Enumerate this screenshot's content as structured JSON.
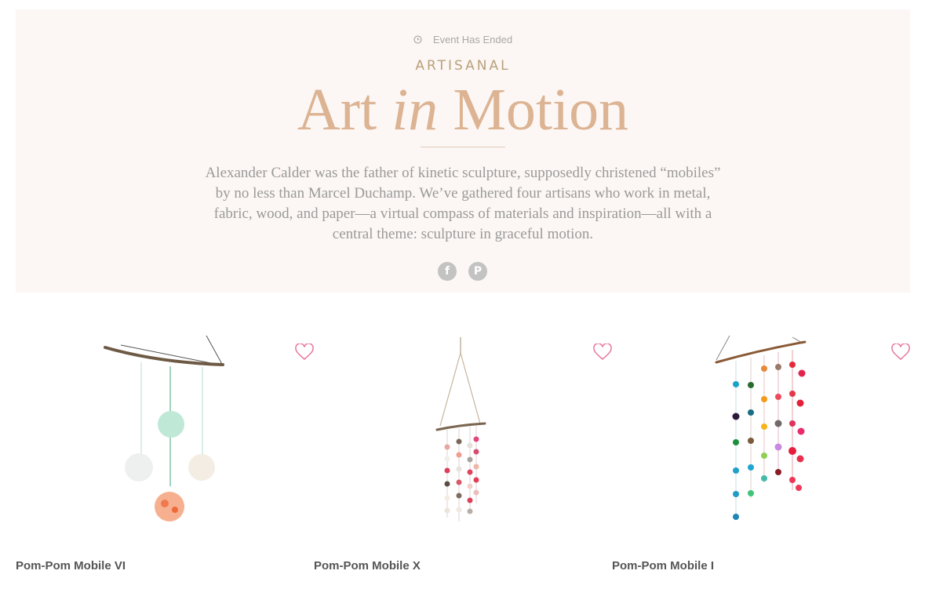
{
  "event": {
    "status": "Event Has Ended",
    "status_icon": "clock-icon"
  },
  "hero": {
    "eyebrow": "ARTISANAL",
    "title_before": "Art ",
    "title_em": "in",
    "title_after": " Motion",
    "description": "Alexander Calder was the father of kinetic sculpture, supposedly christened “mobiles” by no less than Marcel Duchamp. We’ve gathered four artisans who work in metal, fabric, wood, and paper—a virtual compass of materials and inspiration—all with a central theme: sculpture in graceful motion.",
    "background_color": "#fcf7f4",
    "title_color": "#dcb393"
  },
  "share": {
    "facebook_icon": "facebook-icon",
    "facebook_glyph": "f",
    "pinterest_icon": "pinterest-icon",
    "pinterest_glyph": "P"
  },
  "products": [
    {
      "name": "Pom-Pom Mobile VI",
      "image": "pom-pom-mobile-image",
      "favorite_icon": "heart-icon"
    },
    {
      "name": "Pom-Pom Mobile X",
      "image": "pom-pom-mobile-image",
      "favorite_icon": "heart-icon"
    },
    {
      "name": "Pom-Pom Mobile I",
      "image": "pom-pom-mobile-image",
      "favorite_icon": "heart-icon"
    }
  ],
  "colors": {
    "favorite": "#e8769a",
    "product_name": "#555555"
  }
}
